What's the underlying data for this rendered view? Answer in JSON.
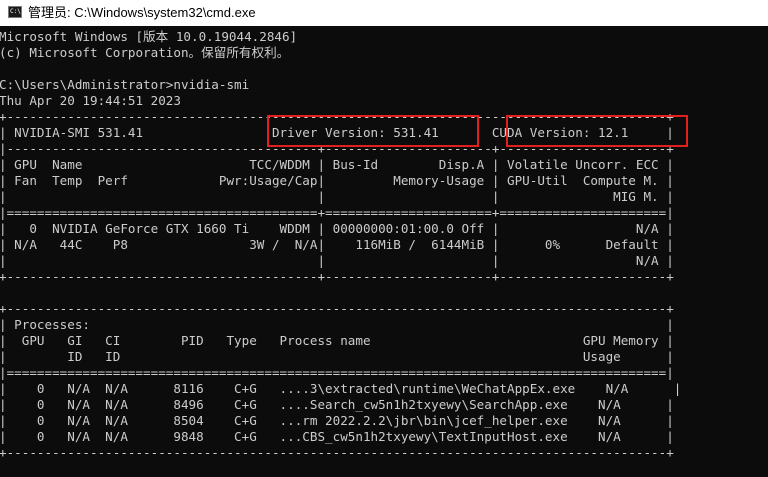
{
  "window": {
    "title": "管理员: C:\\Windows\\system32\\cmd.exe",
    "icon": "cmd-icon"
  },
  "console": {
    "lines": [
      "Microsoft Windows [版本 10.0.19044.2846]",
      "(c) Microsoft Corporation。保留所有权利。",
      "",
      "C:\\Users\\Administrator>nvidia-smi",
      "Thu Apr 20 19:44:51 2023",
      "+---------------------------------------------------------------------------------------+",
      "| NVIDIA-SMI 531.41                 Driver Version: 531.41       CUDA Version: 12.1     |",
      "|-----------------------------------------+----------------------+----------------------+",
      "| GPU  Name                      TCC/WDDM | Bus-Id        Disp.A | Volatile Uncorr. ECC |",
      "| Fan  Temp  Perf            Pwr:Usage/Cap|         Memory-Usage | GPU-Util  Compute M. |",
      "|                                         |                      |               MIG M. |",
      "|=========================================+======================+======================|",
      "|   0  NVIDIA GeForce GTX 1660 Ti    WDDM | 00000000:01:00.0 Off |                  N/A |",
      "| N/A   44C    P8                3W /  N/A|    116MiB /  6144MiB |      0%      Default |",
      "|                                         |                      |                  N/A |",
      "+-----------------------------------------+----------------------+----------------------+",
      "",
      "+---------------------------------------------------------------------------------------+",
      "| Processes:                                                                            |",
      "|  GPU   GI   CI        PID   Type   Process name                            GPU Memory |",
      "|        ID   ID                                                             Usage      |",
      "|=======================================================================================|",
      "|    0   N/A  N/A      8116    C+G   ....3\\extracted\\runtime\\WeChatAppEx.exe    N/A      |",
      "|    0   N/A  N/A      8496    C+G   ....Search_cw5n1h2txyewy\\SearchApp.exe    N/A      |",
      "|    0   N/A  N/A      8504    C+G   ...rm 2022.2.2\\jbr\\bin\\jcef_helper.exe    N/A      |",
      "|    0   N/A  N/A      9848    C+G   ...CBS_cw5n1h2txyewy\\TextInputHost.exe    N/A      |",
      "+---------------------------------------------------------------------------------------+"
    ]
  },
  "highlights": {
    "driver_version": "Driver Version: 531.41",
    "cuda_version": "CUDA Version: 12.1",
    "color": "#e0211d"
  }
}
